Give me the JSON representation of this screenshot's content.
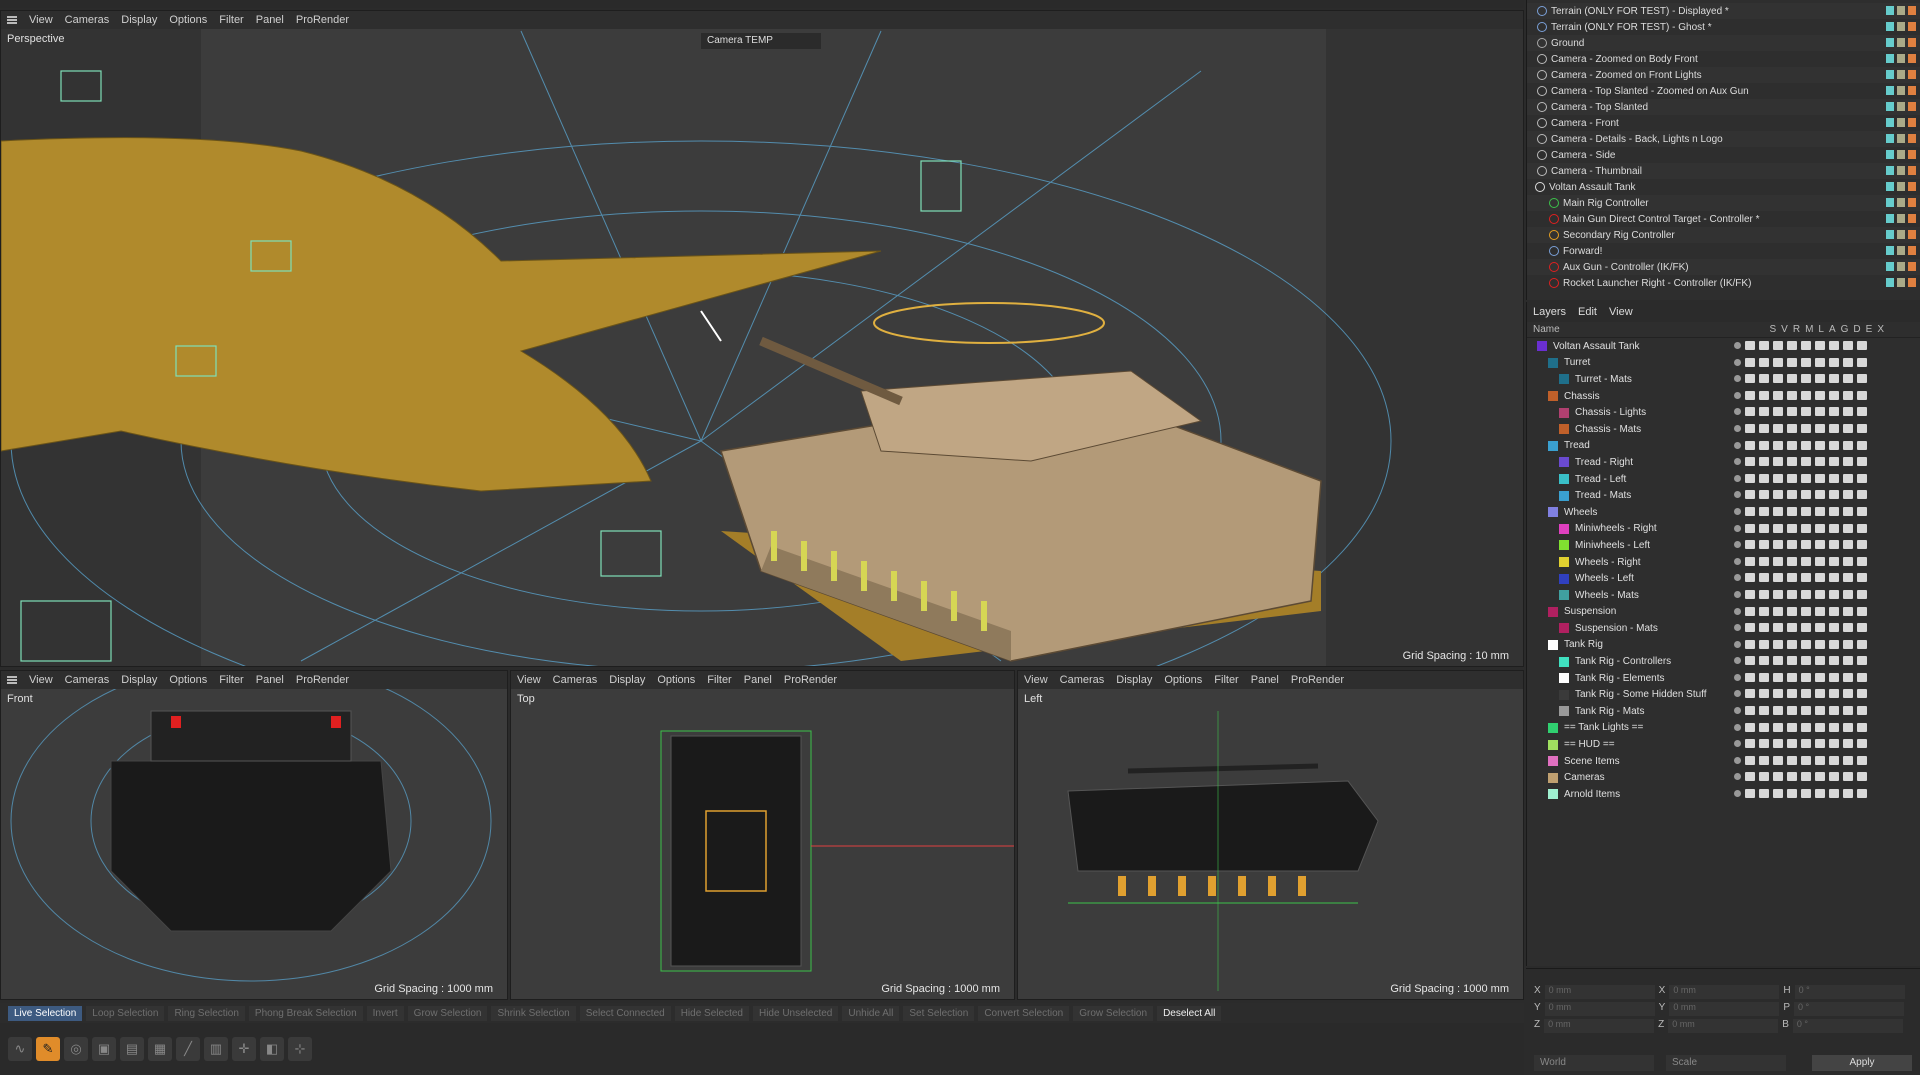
{
  "menus": [
    "View",
    "Cameras",
    "Display",
    "Options",
    "Filter",
    "Panel",
    "ProRender"
  ],
  "viewports": {
    "perspective": {
      "label": "Perspective",
      "camera": "Camera TEMP",
      "grid": "Grid Spacing : 10 mm"
    },
    "front": {
      "label": "Front",
      "grid": "Grid Spacing : 1000 mm"
    },
    "top": {
      "label": "Top",
      "grid": "Grid Spacing : 1000 mm"
    },
    "left": {
      "label": "Left",
      "grid": "Grid Spacing : 1000 mm"
    }
  },
  "selection_bar": [
    "Live Selection",
    "Loop Selection",
    "Ring Selection",
    "Phong Break Selection",
    "Invert",
    "Grow Selection",
    "Shrink Selection",
    "Select Connected",
    "Hide Selected",
    "Hide Unselected",
    "Unhide All",
    "Set Selection",
    "Convert Selection",
    "Grow Selection",
    "Deselect All"
  ],
  "objects": [
    {
      "name": "Terrain (ONLY FOR TEST) - Displayed *",
      "color": "#7aa0d8"
    },
    {
      "name": "Terrain (ONLY FOR TEST) - Ghost *",
      "color": "#7aa0d8"
    },
    {
      "name": "Ground",
      "color": "#aaaaaa"
    },
    {
      "name": "Camera - Zoomed on Body Front",
      "color": "#bbbbbb"
    },
    {
      "name": "Camera - Zoomed on Front Lights",
      "color": "#bbbbbb"
    },
    {
      "name": "Camera - Top Slanted - Zoomed on Aux Gun",
      "color": "#bbbbbb"
    },
    {
      "name": "Camera - Top Slanted",
      "color": "#bbbbbb"
    },
    {
      "name": "Camera - Front",
      "color": "#bbbbbb"
    },
    {
      "name": "Camera - Details - Back, Lights n Logo",
      "color": "#bbbbbb"
    },
    {
      "name": "Camera - Side",
      "color": "#bbbbbb"
    },
    {
      "name": "Camera - Thumbnail",
      "color": "#bbbbbb"
    },
    {
      "name": "Voltan Assault Tank",
      "color": "#dddddd"
    },
    {
      "name": "Main Rig Controller",
      "color": "#3cc24a"
    },
    {
      "name": "Main Gun Direct Control Target - Controller *",
      "color": "#e02020"
    },
    {
      "name": "Secondary Rig Controller",
      "color": "#e8a020"
    },
    {
      "name": "Forward!",
      "color": "#7aa0d8"
    },
    {
      "name": "Aux Gun - Controller (IK/FK)",
      "color": "#e02020"
    },
    {
      "name": "Rocket Launcher Right  - Controller (IK/FK)",
      "color": "#e02020"
    }
  ],
  "layers_panel": {
    "menu": [
      "Layers",
      "Edit",
      "View"
    ],
    "name_col": "Name",
    "col_letters": [
      "S",
      "V",
      "R",
      "M",
      "L",
      "A",
      "G",
      "D",
      "E",
      "X"
    ],
    "rows": [
      {
        "name": "Voltan Assault Tank",
        "color": "#6a2fd0",
        "indent": 0
      },
      {
        "name": "Turret",
        "color": "#1f6f8a",
        "indent": 1
      },
      {
        "name": "Turret - Mats",
        "color": "#1f6f8a",
        "indent": 2
      },
      {
        "name": "Chassis",
        "color": "#c0602a",
        "indent": 1
      },
      {
        "name": "Chassis - Lights",
        "color": "#b04070",
        "indent": 2
      },
      {
        "name": "Chassis - Mats",
        "color": "#c0602a",
        "indent": 2
      },
      {
        "name": "Tread",
        "color": "#3aa0d0",
        "indent": 1
      },
      {
        "name": "Tread - Right",
        "color": "#6a4ad0",
        "indent": 2
      },
      {
        "name": "Tread - Left",
        "color": "#3ac0c8",
        "indent": 2
      },
      {
        "name": "Tread - Mats",
        "color": "#3aa0d0",
        "indent": 2
      },
      {
        "name": "Wheels",
        "color": "#8080e0",
        "indent": 1
      },
      {
        "name": "Miniwheels - Right",
        "color": "#e040c0",
        "indent": 2
      },
      {
        "name": "Miniwheels - Left",
        "color": "#80e030",
        "indent": 2
      },
      {
        "name": "Wheels - Right",
        "color": "#e0d030",
        "indent": 2
      },
      {
        "name": "Wheels - Left",
        "color": "#3040c0",
        "indent": 2
      },
      {
        "name": "Wheels - Mats",
        "color": "#40a0a0",
        "indent": 2
      },
      {
        "name": "Suspension",
        "color": "#b02060",
        "indent": 1
      },
      {
        "name": "Suspension - Mats",
        "color": "#b02060",
        "indent": 2
      },
      {
        "name": "Tank Rig",
        "color": "#ffffff",
        "indent": 1
      },
      {
        "name": "Tank Rig - Controllers",
        "color": "#40e0c0",
        "indent": 2
      },
      {
        "name": "Tank Rig - Elements",
        "color": "#ffffff",
        "indent": 2
      },
      {
        "name": "Tank Rig - Some Hidden Stuff",
        "color": "#3a3a3a",
        "indent": 2
      },
      {
        "name": "Tank Rig - Mats",
        "color": "#999999",
        "indent": 2
      },
      {
        "name": "== Tank Lights ==",
        "color": "#30d070",
        "indent": 1
      },
      {
        "name": "== HUD ==",
        "color": "#a0e060",
        "indent": 1
      },
      {
        "name": "Scene Items",
        "color": "#e070c0",
        "indent": 1
      },
      {
        "name": "Cameras",
        "color": "#c0a070",
        "indent": 1
      },
      {
        "name": "Arnold Items",
        "color": "#a0f0d0",
        "indent": 1
      }
    ]
  },
  "coordinates": {
    "rows": [
      {
        "a": "X",
        "av": "0 mm",
        "b": "X",
        "bv": "0 mm",
        "c": "H",
        "cv": "0 °"
      },
      {
        "a": "Y",
        "av": "0 mm",
        "b": "Y",
        "bv": "0 mm",
        "c": "P",
        "cv": "0 °"
      },
      {
        "a": "Z",
        "av": "0 mm",
        "b": "Z",
        "bv": "0 mm",
        "c": "B",
        "cv": "0 °"
      }
    ],
    "world": "World",
    "scale": "Scale",
    "apply": "Apply"
  }
}
